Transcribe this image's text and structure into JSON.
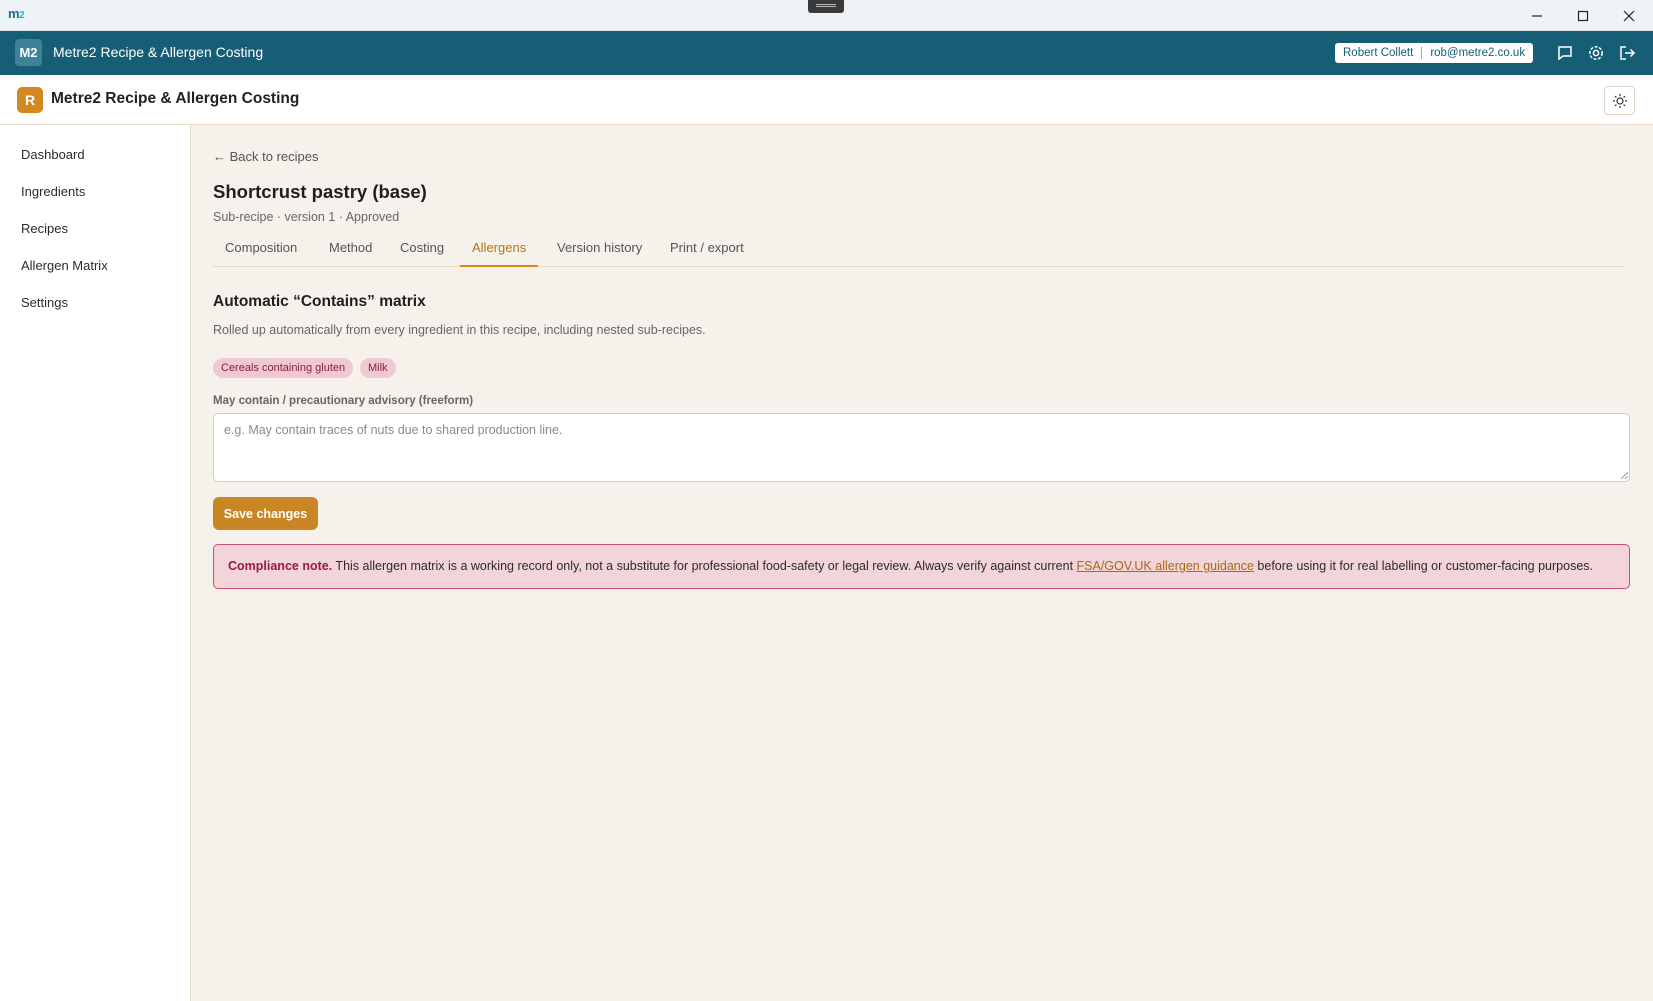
{
  "os": {
    "logo_main": "m",
    "logo_sub": "2"
  },
  "header": {
    "badge": "M2",
    "title": "Metre2 Recipe & Allergen Costing",
    "user_name": "Robert Collett",
    "user_email": "rob@metre2.co.uk"
  },
  "subheader": {
    "badge": "R",
    "title": "Metre2 Recipe & Allergen Costing"
  },
  "sidebar": {
    "items": [
      {
        "label": "Dashboard"
      },
      {
        "label": "Ingredients"
      },
      {
        "label": "Recipes"
      },
      {
        "label": "Allergen Matrix"
      },
      {
        "label": "Settings"
      }
    ]
  },
  "main": {
    "back_link": "← Back to recipes",
    "title": "Shortcrust pastry (base)",
    "subtitle": "Sub-recipe · version 1 · Approved",
    "tabs": [
      {
        "label": "Composition"
      },
      {
        "label": "Method"
      },
      {
        "label": "Costing"
      },
      {
        "label": "Allergens"
      },
      {
        "label": "Version history"
      },
      {
        "label": "Print / export"
      }
    ],
    "active_tab": "Allergens",
    "section_title": "Automatic “Contains” matrix",
    "section_desc": "Rolled up automatically from every ingredient in this recipe, including nested sub-recipes.",
    "allergens": [
      "Cereals containing gluten",
      "Milk"
    ],
    "advisory_label": "May contain / precautionary advisory (freeform)",
    "advisory_placeholder": "e.g. May contain traces of nuts due to shared production line.",
    "advisory_value": "",
    "save_label": "Save changes",
    "notice": {
      "strong": "Compliance note.",
      "text_before": " This allergen matrix is a working record only, not a substitute for professional food-safety or legal review. Always verify against current ",
      "link": "FSA/GOV.UK allergen guidance",
      "text_after": " before using it for real labelling or customer-facing purposes."
    }
  },
  "colors": {
    "header_bg": "#155e75",
    "accent": "#d4891f",
    "chip_bg": "#efc9d0",
    "chip_text": "#8b1f3d",
    "notice_border": "#c7506a",
    "page_bg": "#f6f1ea"
  }
}
